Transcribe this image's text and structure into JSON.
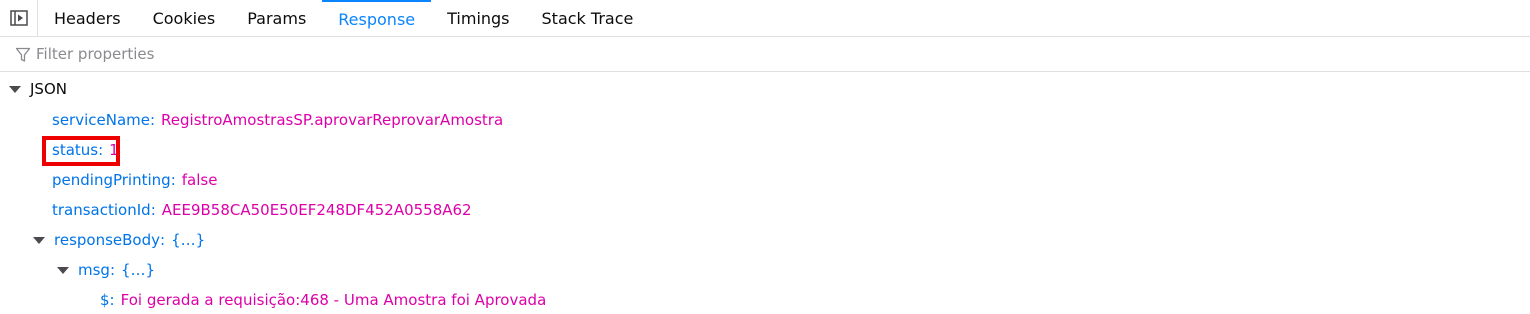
{
  "tabs": [
    {
      "label": "Headers",
      "active": false
    },
    {
      "label": "Cookies",
      "active": false
    },
    {
      "label": "Params",
      "active": false
    },
    {
      "label": "Response",
      "active": true
    },
    {
      "label": "Timings",
      "active": false
    },
    {
      "label": "Stack Trace",
      "active": false
    }
  ],
  "filter": {
    "placeholder": "Filter properties",
    "value": ""
  },
  "tree": {
    "section_label": "JSON",
    "service_name": {
      "key": "serviceName",
      "value": "RegistroAmostrasSP.aprovarReprovarAmostra"
    },
    "status": {
      "key": "status",
      "value": "1"
    },
    "pending_printing": {
      "key": "pendingPrinting",
      "value": "false"
    },
    "transaction_id": {
      "key": "transactionId",
      "value": "AEE9B58CA50E50EF248DF452A0558A62"
    },
    "response_body": {
      "key": "responseBody",
      "value": "{…}"
    },
    "msg": {
      "key": "msg",
      "value": "{…}"
    },
    "message": {
      "key": "$",
      "value": "Foi gerada a requisição:468 - Uma Amostra foi Aprovada"
    },
    "separator": ":"
  },
  "colors": {
    "accent": "#0a84ff",
    "key": "#0074e8",
    "value": "#dd00a9",
    "highlight": "#ee0000"
  },
  "icons": {
    "toggle": "sidebar-toggle-icon",
    "filter": "filter-icon",
    "twisty": "expanded-twisty-icon"
  }
}
